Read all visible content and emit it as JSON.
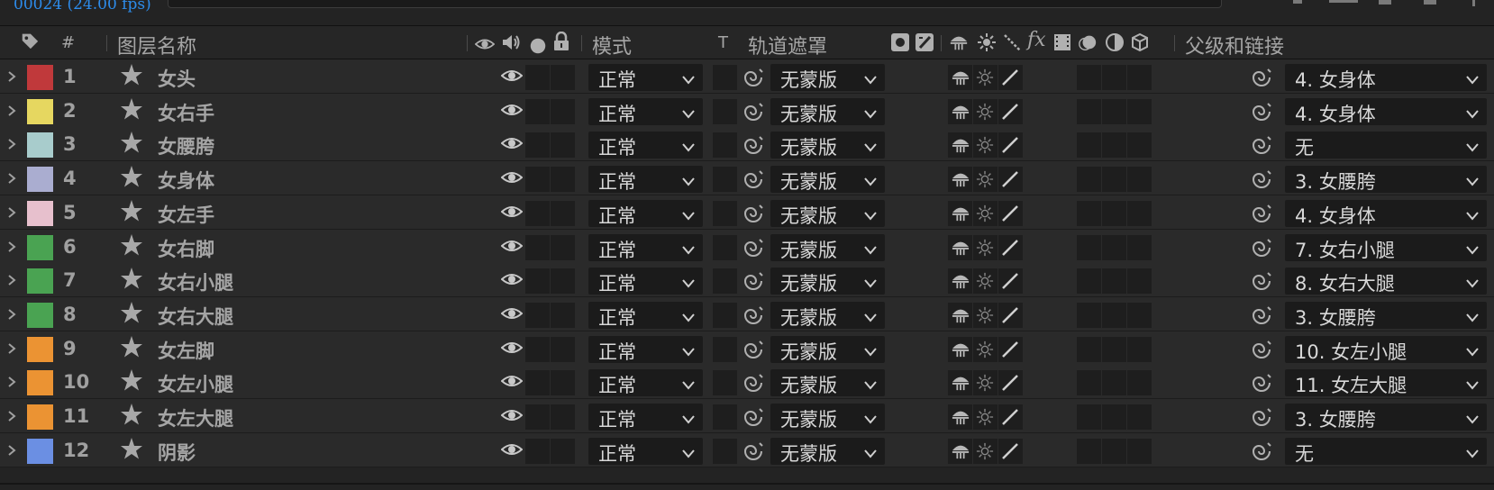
{
  "timecode": "00024 (24.00 fps)",
  "columns": {
    "label_icon": "label-tag-icon",
    "number": "#",
    "layer_name": "图层名称",
    "mode": "模式",
    "t": "T",
    "track_matte": "轨道遮罩",
    "fx": "fx",
    "parent": "父级和链接"
  },
  "colors": {
    "background": "#232323",
    "row": "#2a2a2a",
    "accent_timecode": "#2d8ceb"
  },
  "layers": [
    {
      "number": "1",
      "name": "女头",
      "label_color": "#c0393b",
      "mode": "正常",
      "matte": "无蒙版",
      "parent": "4. 女身体"
    },
    {
      "number": "2",
      "name": "女右手",
      "label_color": "#e6d760",
      "mode": "正常",
      "matte": "无蒙版",
      "parent": "4. 女身体"
    },
    {
      "number": "3",
      "name": "女腰胯",
      "label_color": "#a8cccc",
      "mode": "正常",
      "matte": "无蒙版",
      "parent": "无"
    },
    {
      "number": "4",
      "name": "女身体",
      "label_color": "#aaadd0",
      "mode": "正常",
      "matte": "无蒙版",
      "parent": "3. 女腰胯"
    },
    {
      "number": "5",
      "name": "女左手",
      "label_color": "#e7c0cd",
      "mode": "正常",
      "matte": "无蒙版",
      "parent": "4. 女身体"
    },
    {
      "number": "6",
      "name": "女右脚",
      "label_color": "#4aa352",
      "mode": "正常",
      "matte": "无蒙版",
      "parent": "7. 女右小腿"
    },
    {
      "number": "7",
      "name": "女右小腿",
      "label_color": "#4aa352",
      "mode": "正常",
      "matte": "无蒙版",
      "parent": "8. 女右大腿"
    },
    {
      "number": "8",
      "name": "女右大腿",
      "label_color": "#4aa352",
      "mode": "正常",
      "matte": "无蒙版",
      "parent": "3. 女腰胯"
    },
    {
      "number": "9",
      "name": "女左脚",
      "label_color": "#eb9333",
      "mode": "正常",
      "matte": "无蒙版",
      "parent": "10. 女左小腿"
    },
    {
      "number": "10",
      "name": "女左小腿",
      "label_color": "#eb9333",
      "mode": "正常",
      "matte": "无蒙版",
      "parent": "11. 女左大腿"
    },
    {
      "number": "11",
      "name": "女左大腿",
      "label_color": "#eb9333",
      "mode": "正常",
      "matte": "无蒙版",
      "parent": "3. 女腰胯"
    },
    {
      "number": "12",
      "name": "阴影",
      "label_color": "#6b8fe3",
      "mode": "正常",
      "matte": "无蒙版",
      "parent": "无"
    }
  ]
}
